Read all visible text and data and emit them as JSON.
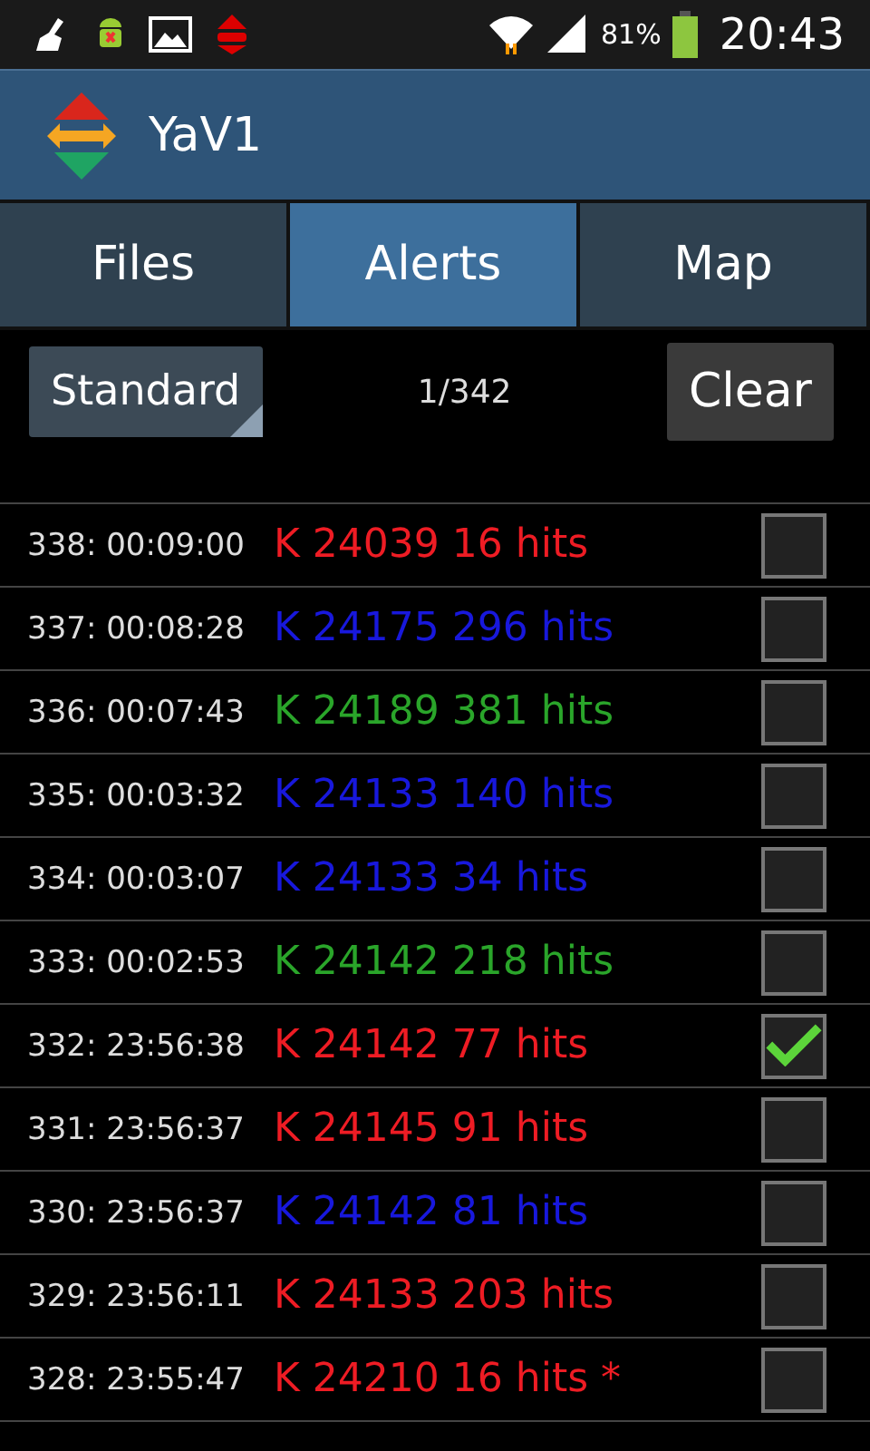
{
  "status_bar": {
    "battery_percent": "81%",
    "time": "20:43"
  },
  "app_bar": {
    "title": "YaV1"
  },
  "tabs": [
    {
      "label": "Files",
      "selected": false
    },
    {
      "label": "Alerts",
      "selected": true
    },
    {
      "label": "Map",
      "selected": false
    }
  ],
  "toolbar": {
    "dropdown": "Standard",
    "counter": "1/342",
    "clear_button": "Clear"
  },
  "alerts": [
    {
      "time": "338: 00:09:00",
      "text": "K 24039 16 hits",
      "color": "#ee1c24",
      "checked": false
    },
    {
      "time": "337: 00:08:28",
      "text": "K 24175 296 hits",
      "color": "#1818dc",
      "checked": false
    },
    {
      "time": "336: 00:07:43",
      "text": "K 24189 381 hits",
      "color": "#2aa52a",
      "checked": false
    },
    {
      "time": "335: 00:03:32",
      "text": "K 24133 140 hits",
      "color": "#1818dc",
      "checked": false
    },
    {
      "time": "334: 00:03:07",
      "text": "K 24133 34 hits",
      "color": "#1818dc",
      "checked": false
    },
    {
      "time": "333: 00:02:53",
      "text": "K 24142 218 hits",
      "color": "#2aa52a",
      "checked": false
    },
    {
      "time": "332: 23:56:38",
      "text": "K 24142 77 hits",
      "color": "#ee1c24",
      "checked": true
    },
    {
      "time": "331: 23:56:37",
      "text": "K 24145 91 hits",
      "color": "#ee1c24",
      "checked": false
    },
    {
      "time": "330: 23:56:37",
      "text": "K 24142 81 hits",
      "color": "#1818dc",
      "checked": false
    },
    {
      "time": "329: 23:56:11",
      "text": "K 24133 203 hits",
      "color": "#ee1c24",
      "checked": false
    },
    {
      "time": "328: 23:55:47",
      "text": "K 24210 16 hits *",
      "color": "#ee1c24",
      "checked": false
    }
  ]
}
